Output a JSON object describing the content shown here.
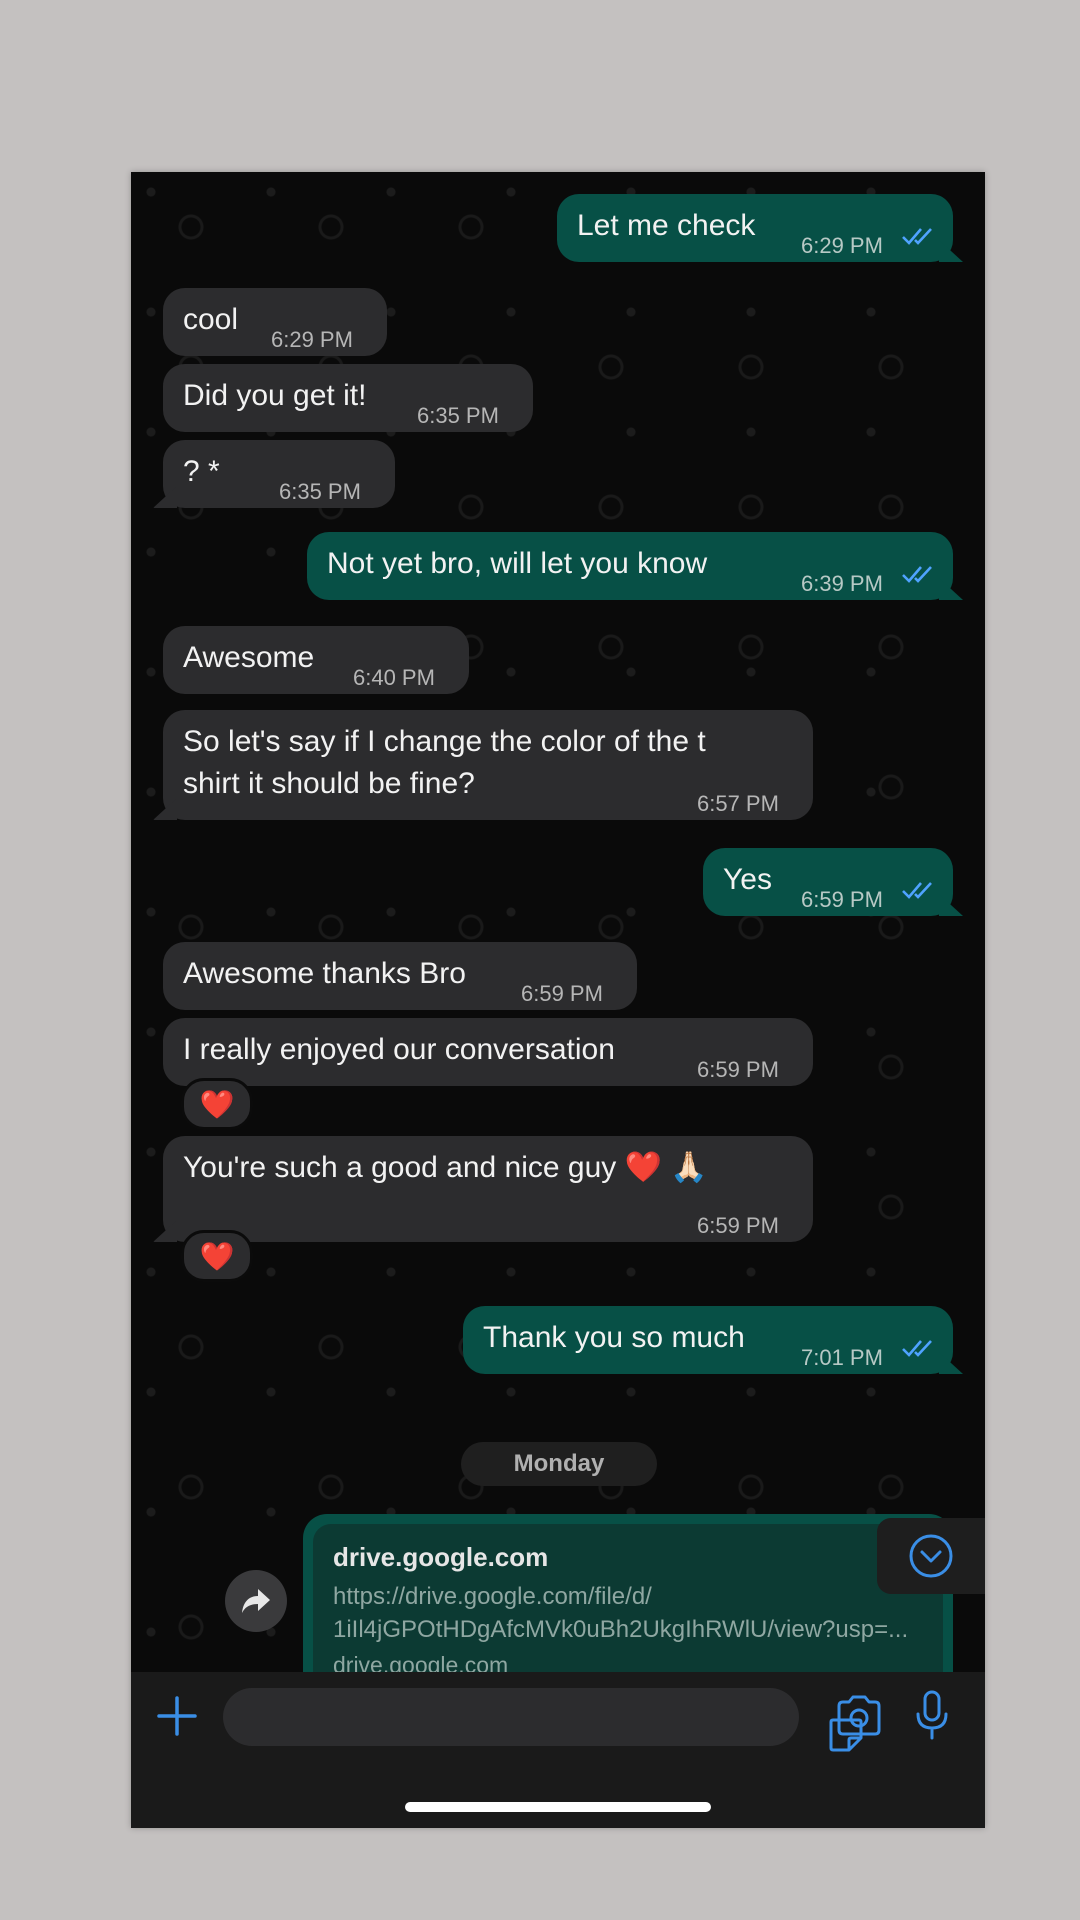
{
  "messages": [
    {
      "dir": "out",
      "text": "Let me check",
      "time": "6:29 PM"
    },
    {
      "dir": "in",
      "text": "cool",
      "time": "6:29 PM"
    },
    {
      "dir": "in",
      "text": "Did you get it!",
      "time": "6:35 PM"
    },
    {
      "dir": "in",
      "text": "? *",
      "time": "6:35 PM"
    },
    {
      "dir": "out",
      "text": "Not yet bro, will let you know",
      "time": "6:39 PM"
    },
    {
      "dir": "in",
      "text": "Awesome",
      "time": "6:40 PM"
    },
    {
      "dir": "in",
      "line1": "So let's say if I change the color of the t",
      "line2": "shirt it should be fine?",
      "time": "6:57 PM"
    },
    {
      "dir": "out",
      "text": "Yes",
      "time": "6:59 PM"
    },
    {
      "dir": "in",
      "text": "Awesome thanks Bro",
      "time": "6:59 PM"
    },
    {
      "dir": "in",
      "text": "I really enjoyed our conversation",
      "time": "6:59 PM",
      "reaction": "❤️"
    },
    {
      "dir": "in",
      "text": "You're such a good and nice guy ❤️ 🙏🏻",
      "time": "6:59 PM",
      "reaction": "❤️"
    },
    {
      "dir": "out",
      "text": "Thank you so much",
      "time": "7:01 PM"
    }
  ],
  "date_separator": "Monday",
  "link_preview": {
    "title": "drive.google.com",
    "url_line1": "https://drive.google.com/file/d/",
    "url_line2": "1iIl4jGPOtHDgAfcMVk0uBh2UkgIhRWlU/view?usp=...",
    "domain": "drive.google.com"
  },
  "colors": {
    "outgoing_bubble": "#075046",
    "incoming_bubble": "#2c2c2e",
    "accent_blue": "#3a8ee6",
    "read_ticks": "#4fa3ff"
  },
  "icons": [
    "plus-icon",
    "sticker-icon",
    "camera-icon",
    "microphone-icon",
    "forward-icon",
    "chevron-down-icon",
    "double-check-icon"
  ]
}
